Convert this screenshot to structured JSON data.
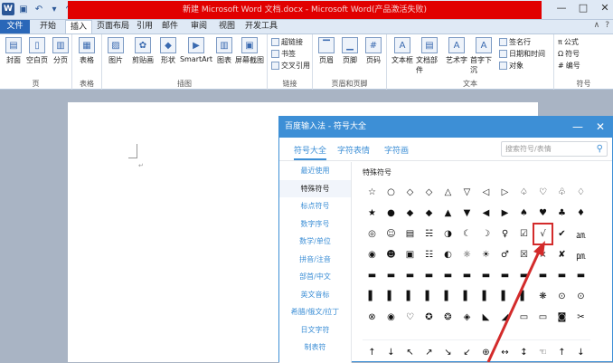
{
  "window": {
    "title": "新建 Microsoft Word 文档.docx - Microsoft Word(产品激活失败)",
    "controls": [
      "—",
      "□",
      "✕"
    ]
  },
  "tabs": [
    "文件",
    "开始",
    "插入",
    "页面布局",
    "引用",
    "邮件",
    "审阅",
    "视图",
    "开发工具"
  ],
  "ribbon": {
    "groups": [
      "页",
      "表格",
      "插图",
      "链接",
      "页眉和页脚",
      "文本",
      "符号"
    ],
    "page_buttons": [
      "封面",
      "空白页",
      "分页"
    ],
    "table_button": "表格",
    "illustration_buttons": [
      "图片",
      "剪贴画",
      "形状",
      "SmartArt",
      "图表",
      "屏幕截图"
    ],
    "link_buttons": [
      "超链接",
      "书签",
      "交叉引用"
    ],
    "header_buttons": [
      "页眉",
      "页脚",
      "页码"
    ],
    "text_buttons": [
      "文本框",
      "文档部件",
      "艺术字",
      "首字下沉"
    ],
    "text_small": [
      "签名行",
      "日期和时间",
      "对象"
    ],
    "symbol_buttons": [
      "公式",
      "符号",
      "编号"
    ]
  },
  "dialog": {
    "title": "百度输入法 - 符号大全",
    "tabs": [
      "符号大全",
      "字符表情",
      "字符画"
    ],
    "search_placeholder": "搜索符号/表情",
    "categories": [
      "最近使用",
      "特殊符号",
      "标点符号",
      "数字序号",
      "数学/单位",
      "拼音/注音",
      "部首/中文",
      "英文音标",
      "希腊/俄文/拉丁",
      "日文字符",
      "制表符"
    ],
    "active_category": "特殊符号",
    "section_title": "特殊符号",
    "symbols": [
      "☆",
      "○",
      "◇",
      "◇",
      "△",
      "▽",
      "◁",
      "▷",
      "♤",
      "♡",
      "♧",
      "♢",
      "★",
      "●",
      "◆",
      "◆",
      "▲",
      "▼",
      "◀",
      "▶",
      "♠",
      "♥",
      "♣",
      "♦",
      "◎",
      "☺",
      "▤",
      "☵",
      "◑",
      "☾",
      "☽",
      "♀",
      "☑",
      "√",
      "✔",
      "㏂",
      "◉",
      "☻",
      "▣",
      "☷",
      "◐",
      "☼",
      "☀",
      "♂",
      "☒",
      "×",
      "✘",
      "㏘",
      "▬",
      "▬",
      "▬",
      "▬",
      "▬",
      "▬",
      "▬",
      "▬",
      "▬",
      "▬",
      "▬",
      "▬",
      "▌",
      "▌",
      "▌",
      "▌",
      "▌",
      "▌",
      "▌",
      "▌",
      "▌",
      "❋",
      "⊙",
      "⊙",
      "⊗",
      "◉",
      "♡",
      "✪",
      "❂",
      "◈",
      "◣",
      "◢",
      "▭",
      "▭",
      "◙",
      "✂"
    ],
    "symbols_row2": [
      "↑",
      "↓",
      "↖",
      "↗",
      "↘",
      "↙",
      "⊕",
      "↔",
      "↕",
      "☜",
      "↑",
      "↓"
    ],
    "highlighted_symbol": "√"
  }
}
